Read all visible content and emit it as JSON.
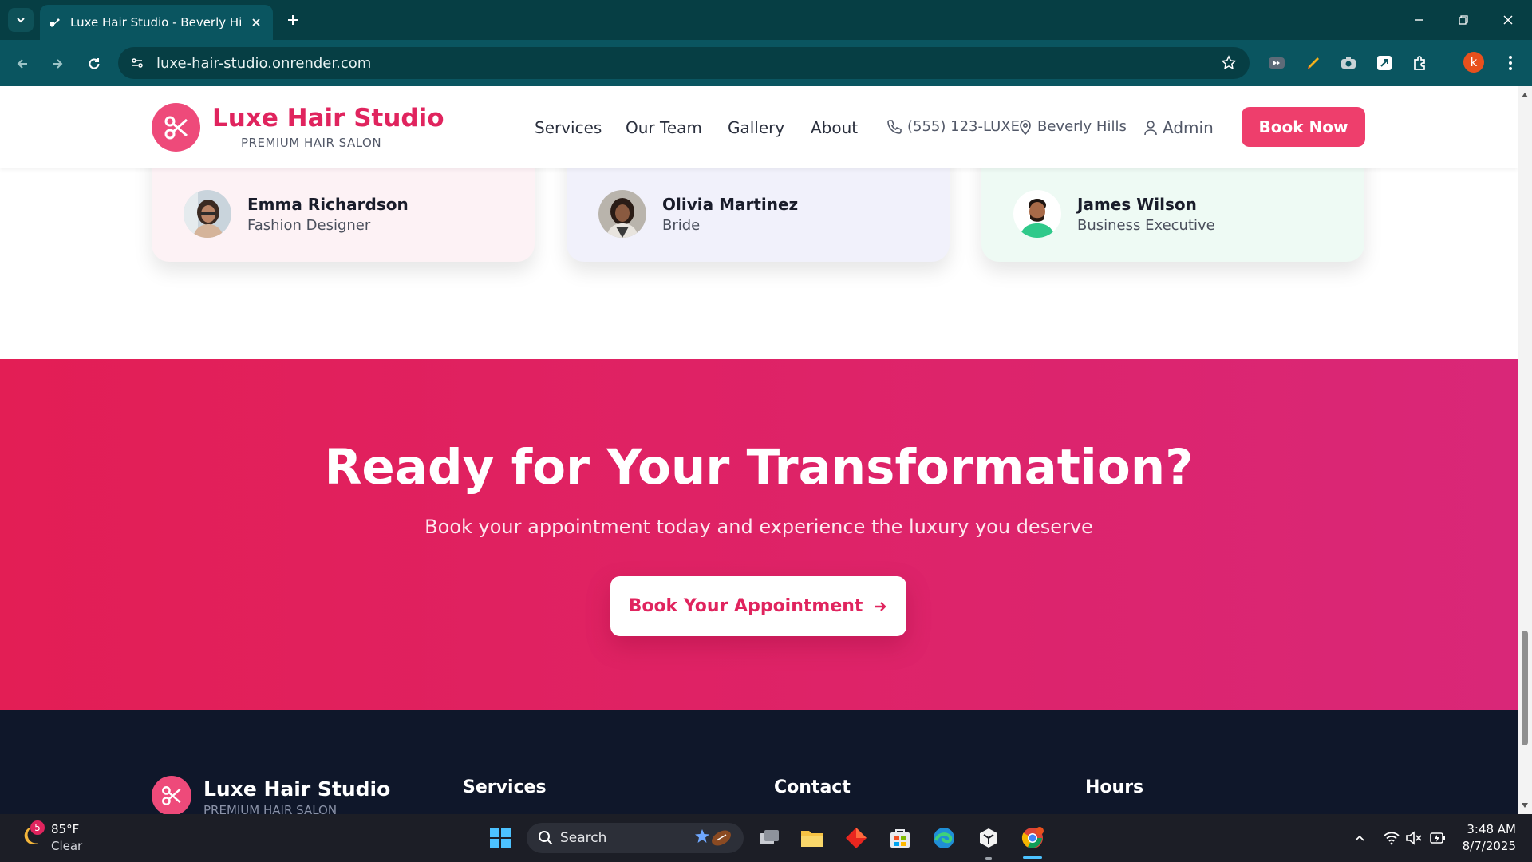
{
  "browser": {
    "tab_title": "Luxe Hair Studio - Beverly Hills |",
    "url": "luxe-hair-studio.onrender.com",
    "profile_initial": "k"
  },
  "header": {
    "brand_name": "Luxe Hair Studio",
    "brand_tagline": "PREMIUM HAIR SALON",
    "nav": {
      "services": "Services",
      "team": "Our Team",
      "gallery": "Gallery",
      "about": "About"
    },
    "phone": "(555) 123-LUXE",
    "location": "Beverly Hills",
    "admin": "Admin",
    "book_now": "Book Now"
  },
  "testimonials": [
    {
      "name": "Emma Richardson",
      "role": "Fashion Designer"
    },
    {
      "name": "Olivia Martinez",
      "role": "Bride"
    },
    {
      "name": "James Wilson",
      "role": "Business Executive"
    }
  ],
  "cta": {
    "title": "Ready for Your Transformation?",
    "subtitle": "Book your appointment today and experience the luxury you deserve",
    "button": "Book Your Appointment"
  },
  "footer": {
    "brand_name": "Luxe Hair Studio",
    "brand_tagline": "PREMIUM HAIR SALON",
    "col_services": "Services",
    "col_contact": "Contact",
    "col_hours": "Hours"
  },
  "taskbar": {
    "weather_badge": "5",
    "weather_temp": "85°F",
    "weather_desc": "Clear",
    "search_label": "Search",
    "time": "3:48 AM",
    "date": "8/7/2025"
  },
  "colors": {
    "brand": "#e0245e",
    "brand_button": "#ee3e6c",
    "footer_bg": "#0f172a",
    "chrome_bg": "#063e44"
  }
}
